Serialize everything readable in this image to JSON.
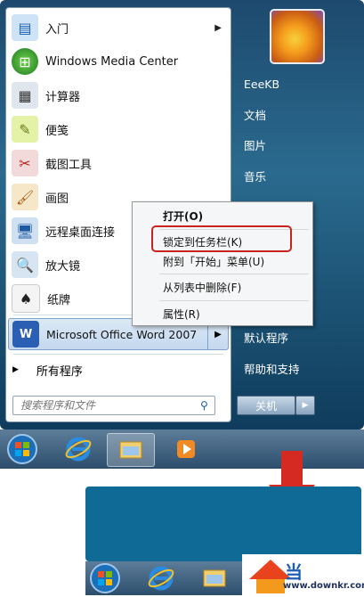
{
  "start_menu": {
    "left_items": [
      {
        "label": "入门",
        "icon": "getting-started-icon",
        "has_arrow": true
      },
      {
        "label": "Windows Media Center",
        "icon": "media-center-icon",
        "has_arrow": false
      },
      {
        "label": "计算器",
        "icon": "calculator-icon",
        "has_arrow": false
      },
      {
        "label": "便笺",
        "icon": "sticky-notes-icon",
        "has_arrow": false
      },
      {
        "label": "截图工具",
        "icon": "snipping-tool-icon",
        "has_arrow": false
      },
      {
        "label": "画图",
        "icon": "paint-icon",
        "has_arrow": false
      },
      {
        "label": "远程桌面连接",
        "icon": "remote-desktop-icon",
        "has_arrow": false
      },
      {
        "label": "放大镜",
        "icon": "magnifier-icon",
        "has_arrow": false
      },
      {
        "label": "纸牌",
        "icon": "solitaire-icon",
        "has_arrow": false
      },
      {
        "label": "Microsoft Office Word 2007",
        "icon": "word-icon",
        "has_arrow": true
      }
    ],
    "all_programs": "所有程序",
    "search_placeholder": "搜索程序和文件",
    "right_items": [
      "EeeKB",
      "文档",
      "图片",
      "音乐",
      "默认程序",
      "帮助和支持"
    ],
    "shutdown_label": "关机"
  },
  "context_menu": {
    "items": [
      "打开(O)",
      "锁定到任务栏(K)",
      "附到「开始」菜单(U)",
      "从列表中删除(F)",
      "属性(R)"
    ],
    "highlight_color": "#c8241e"
  },
  "taskbar": {
    "icons": [
      "start-orb-icon",
      "internet-explorer-icon",
      "explorer-folder-icon",
      "media-player-icon"
    ]
  },
  "preview_taskbar": {
    "icons": [
      "start-orb-icon",
      "internet-explorer-icon",
      "explorer-folder-icon"
    ]
  },
  "watermark": {
    "text": "www.downkr.com",
    "logo_text": "当"
  },
  "colors": {
    "accent_blue": "#0f6b96",
    "arrow_red": "#d42a22"
  }
}
